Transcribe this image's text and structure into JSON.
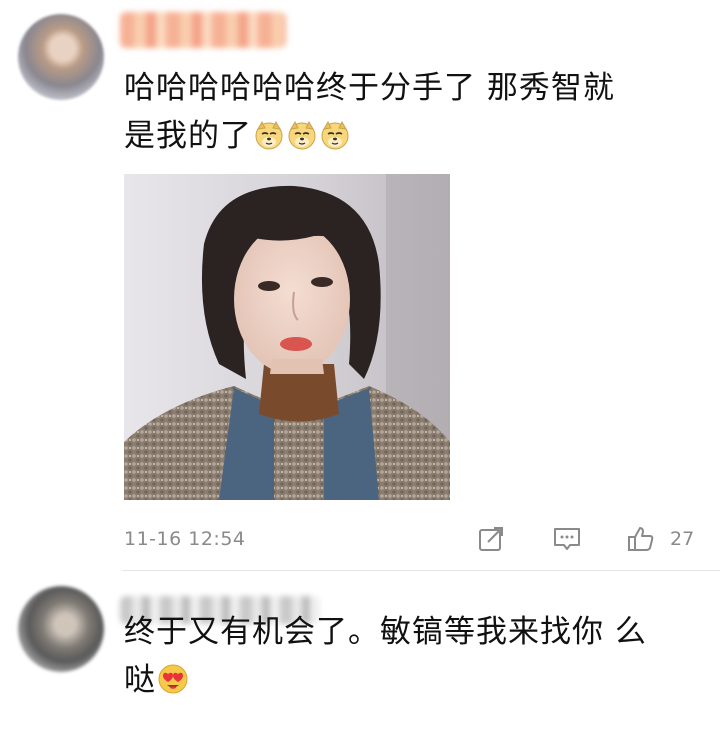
{
  "comments": [
    {
      "text_line1": "哈哈哈哈哈哈终于分手了  那秀智就",
      "text_line2": "是我的了",
      "emojis": [
        "doge-emoji",
        "doge-emoji",
        "doge-emoji"
      ],
      "timestamp": "11-16 12:54",
      "likes": "27",
      "has_image": true
    },
    {
      "text_line1": "终于又有机会了。敏镐等我来找你 么",
      "text_line2": "哒",
      "emojis": [
        "heart-eyes-emoji"
      ]
    }
  ],
  "icons": {
    "share": "share-icon",
    "comment": "comment-icon",
    "like": "thumbs-up-icon"
  },
  "colors": {
    "text": "#111111",
    "meta": "#8a8a8a",
    "emoji_yellow": "#f7c94b"
  }
}
